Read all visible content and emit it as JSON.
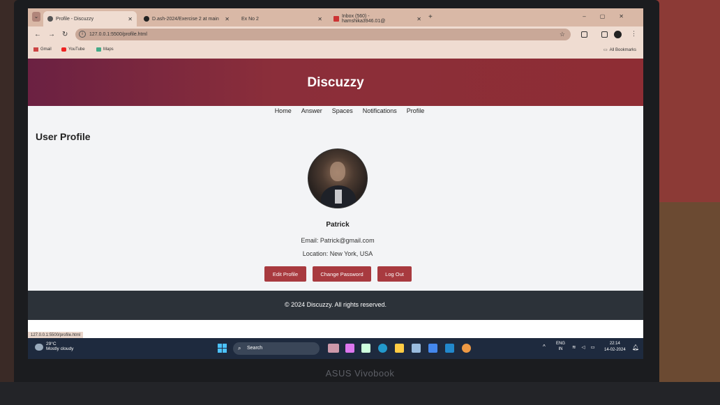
{
  "browser": {
    "tabs": [
      {
        "label": "Profile - Discuzzy",
        "active": true
      },
      {
        "label": "D.ash-2024/Exercise 2 at main"
      },
      {
        "label": "Ex No 2"
      },
      {
        "label": "Inbox (560) - hamshika3946.01@"
      }
    ],
    "url": "127.0.0.1:5500/profile.html",
    "bookmarks": [
      "Gmail",
      "YouTube",
      "Maps"
    ],
    "all_bookmarks": "All Bookmarks",
    "status_url": "127.0.0.1:5500/profile.html"
  },
  "site": {
    "title": "Discuzzy",
    "nav": [
      "Home",
      "Answer",
      "Spaces",
      "Notifications",
      "Profile"
    ],
    "section_title": "User Profile",
    "profile": {
      "name": "Patrick",
      "email": "Email: Patrick@gmail.com",
      "location": "Location: New York, USA"
    },
    "buttons": {
      "edit": "Edit Profile",
      "change_password": "Change Password",
      "logout": "Log Out"
    },
    "footer": "© 2024 Discuzzy. All rights reserved.",
    "header_color": "#8b2e3a",
    "button_color": "#a83a3f",
    "footer_color": "#2c3239"
  },
  "taskbar": {
    "weather_temp": "29°C",
    "weather_desc": "Mostly cloudy",
    "search": "Search",
    "lang_top": "ENG",
    "lang_bottom": "IN",
    "time": "22:14",
    "date": "14-02-2024"
  },
  "laptop_brand": "ASUS Vivobook"
}
